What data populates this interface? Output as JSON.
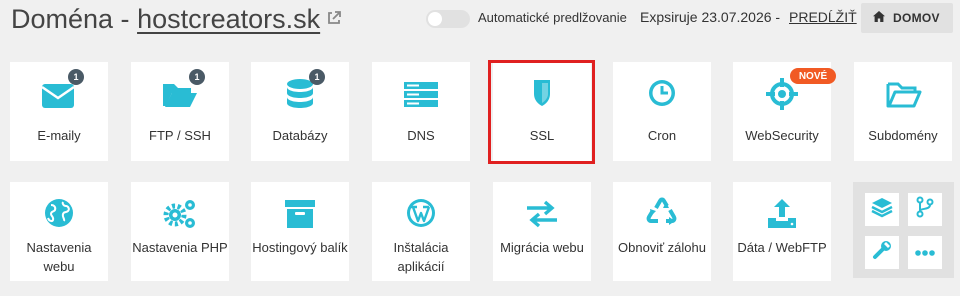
{
  "header": {
    "title_prefix": "Doména - ",
    "domain": "hostcreators.sk",
    "toggle_label": "Automatické predlžovanie",
    "toggle_on": false,
    "expires_text": "Expsiruje 23.07.2026 - ",
    "renew_label": "PREDĹŽIŤ",
    "home_label": "DOMOV"
  },
  "colors": {
    "accent": "#29bcd4",
    "badge": "#4a5a66",
    "new_badge": "#f15a24",
    "selection": "#e02020"
  },
  "tiles": [
    {
      "label": "E-maily",
      "icon": "envelope-icon",
      "badge": "1"
    },
    {
      "label": "FTP / SSH",
      "icon": "folder-open-icon",
      "badge": "1"
    },
    {
      "label": "Databázy",
      "icon": "database-icon",
      "badge": "1"
    },
    {
      "label": "DNS",
      "icon": "server-icon"
    },
    {
      "label": "SSL",
      "icon": "shield-icon",
      "selected": true
    },
    {
      "label": "Cron",
      "icon": "clock-icon"
    },
    {
      "label": "WebSecurity",
      "icon": "crosshair-icon",
      "new_badge": "NOVÉ"
    },
    {
      "label": "Subdomény",
      "icon": "folder-outline-icon"
    },
    {
      "label": "Nastavenia webu",
      "icon": "globe-icon"
    },
    {
      "label": "Nastavenia PHP",
      "icon": "gears-icon"
    },
    {
      "label": "Hostingový balík",
      "icon": "archive-box-icon"
    },
    {
      "label": "Inštalácia aplikácií",
      "icon": "wordpress-icon"
    },
    {
      "label": "Migrácia webu",
      "icon": "exchange-arrows-icon"
    },
    {
      "label": "Obnoviť zálohu",
      "icon": "recycle-icon"
    },
    {
      "label": "Dáta / WebFTP",
      "icon": "upload-tray-icon"
    }
  ],
  "mini_tools": [
    {
      "icon": "layers-icon"
    },
    {
      "icon": "git-branch-icon"
    },
    {
      "icon": "wrench-icon"
    },
    {
      "icon": "more-dots-icon"
    }
  ]
}
